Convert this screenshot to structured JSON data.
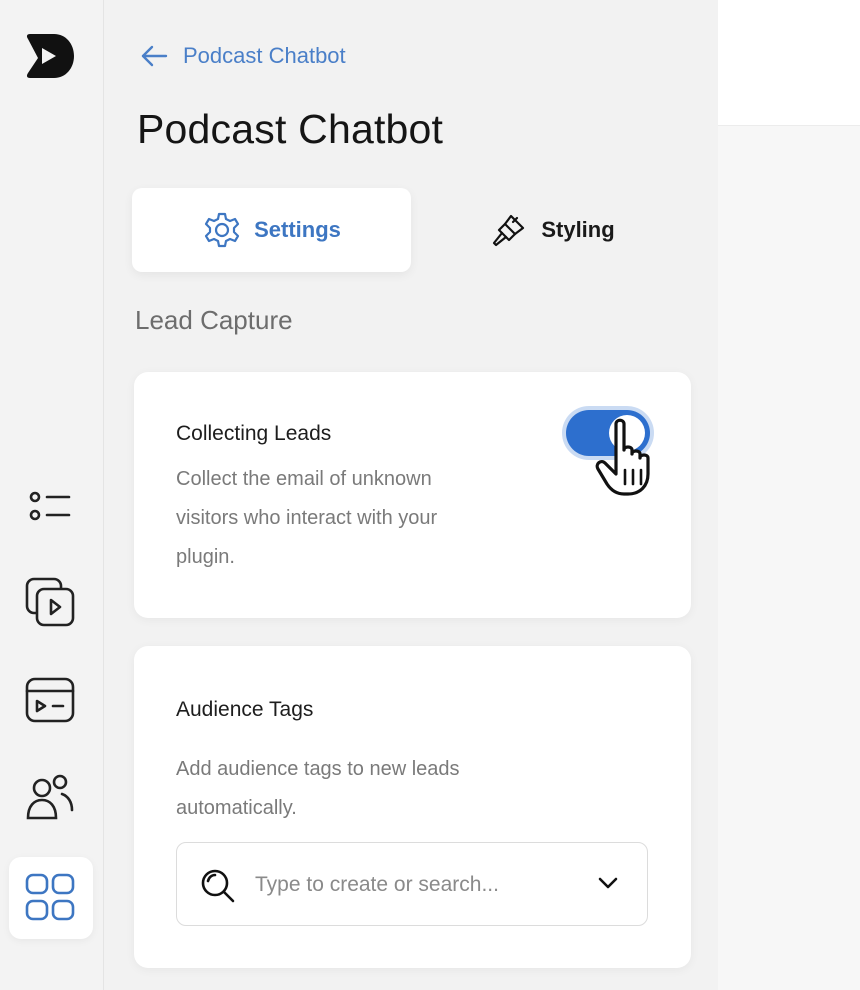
{
  "back_link": {
    "label": "Podcast Chatbot"
  },
  "page": {
    "title": "Podcast Chatbot"
  },
  "tabs": [
    {
      "label": "Settings",
      "icon": "gear-icon",
      "active": true
    },
    {
      "label": "Styling",
      "icon": "paintbrush-icon",
      "active": false
    }
  ],
  "section": {
    "label": "Lead Capture"
  },
  "collecting_leads": {
    "title": "Collecting Leads",
    "description_lines": [
      "Collect the email of unknown",
      "visitors who interact with your",
      "plugin."
    ],
    "enabled": true
  },
  "audience_tags": {
    "title": "Audience Tags",
    "description_lines": [
      "Add audience tags to new leads",
      "automatically."
    ],
    "search_placeholder": "Type to create or search..."
  },
  "rail": {
    "items": [
      "list-icon",
      "video-library-icon",
      "video-card-icon",
      "users-icon",
      "apps-grid-icon"
    ],
    "active": "apps-grid-icon"
  },
  "colors": {
    "accent": "#2d6fce",
    "link": "#4a7fc8",
    "tab_active": "#3d76c2"
  }
}
